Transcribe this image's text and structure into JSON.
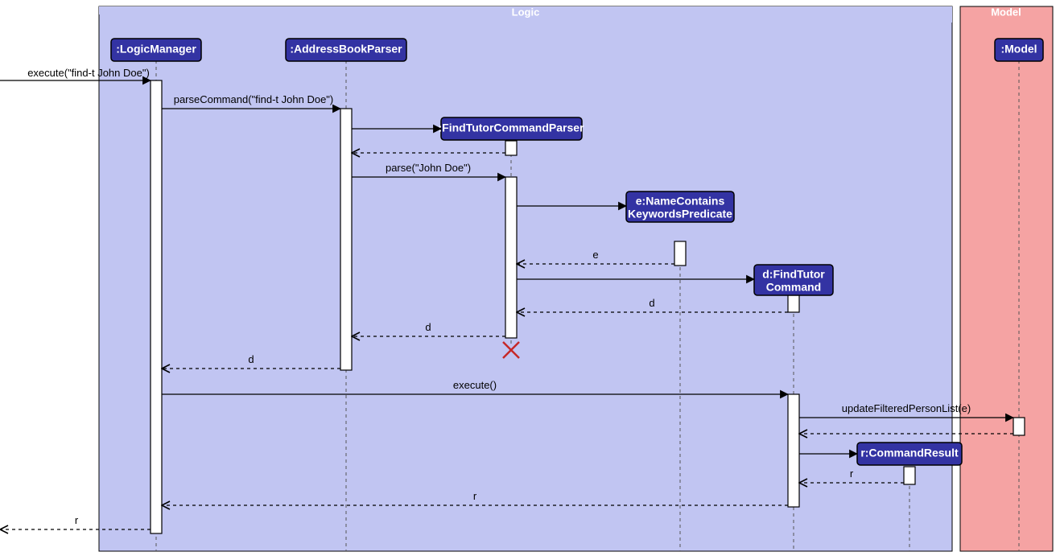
{
  "diagram_type": "sequence",
  "frames": {
    "logic": {
      "label": "Logic"
    },
    "model": {
      "label": "Model"
    }
  },
  "participants": {
    "logicManager": {
      "label": ":LogicManager"
    },
    "addressBookParser": {
      "label": ":AddressBookParser"
    },
    "findTutorCommandParser": {
      "label": ":FindTutorCommandParser"
    },
    "nameContainsKeywordsPredicate": {
      "label1": "e:NameContains",
      "label2": "KeywordsPredicate"
    },
    "findTutorCommand": {
      "label1": "d:FindTutor",
      "label2": "Command"
    },
    "commandResult": {
      "label": "r:CommandResult"
    },
    "model": {
      "label": ":Model"
    }
  },
  "messages": {
    "m1": "execute(\"find-t John Doe\")",
    "m2": "parseCommand(\"find-t John Doe\")",
    "m3": "",
    "m4": "parse(\"John Doe\")",
    "m5": "",
    "m6": "e",
    "m7": "",
    "m8": "d",
    "m9": "d",
    "m10": "d",
    "m11": "execute()",
    "m12": "updateFilteredPersonList(e)",
    "m13": "",
    "m14": "",
    "m15": "r",
    "m16": "r",
    "m17": "r"
  }
}
